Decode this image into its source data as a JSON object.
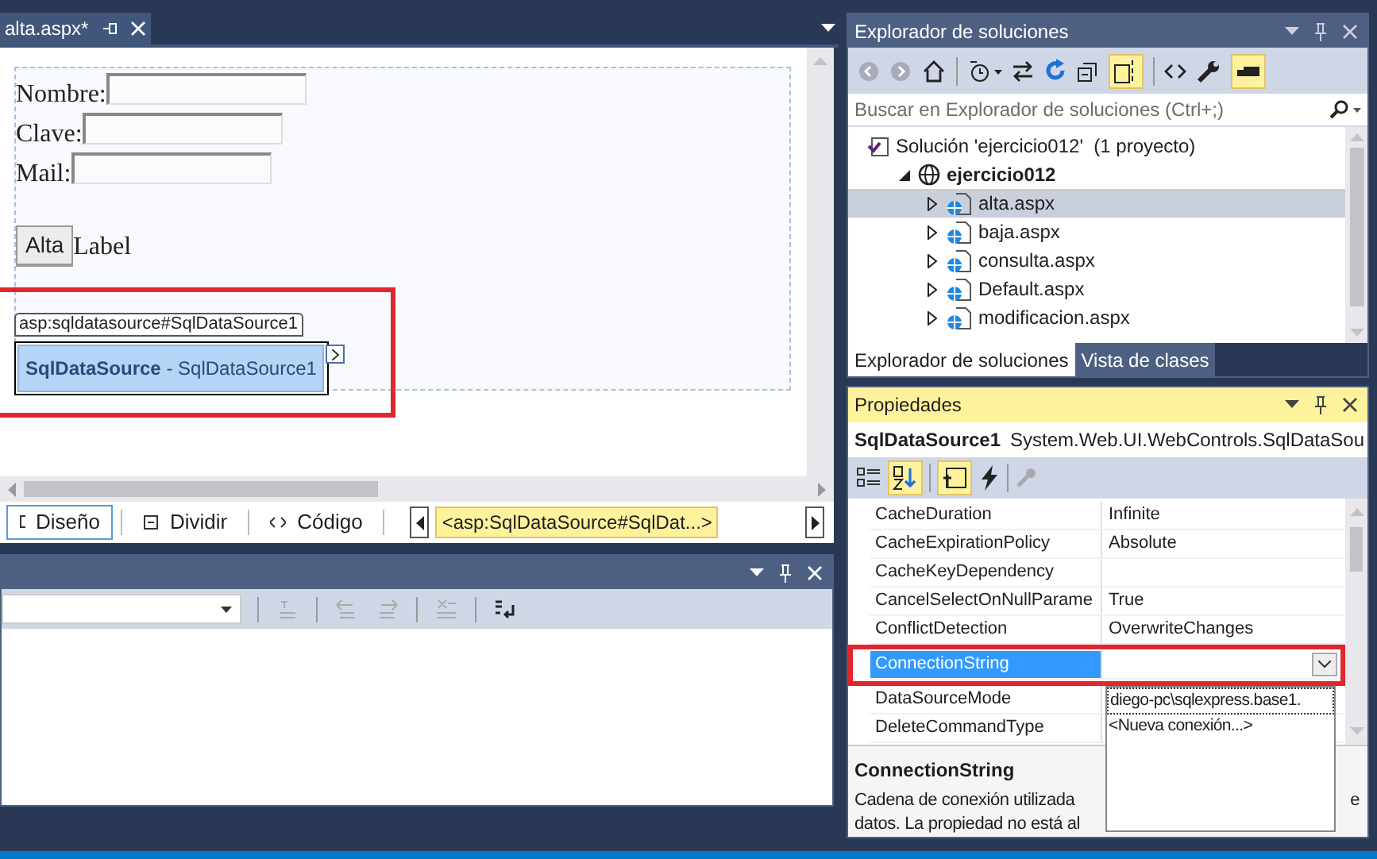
{
  "editor_tab": {
    "title": "alta.aspx*"
  },
  "design_surface": {
    "fields": [
      {
        "label": "Nombre:"
      },
      {
        "label": "Clave:"
      },
      {
        "label": "Mail:"
      }
    ],
    "button": "Alta",
    "label": "Label",
    "smart_tag": {
      "tag": "asp:sqldatasource#SqlDataSource1",
      "caption": "**SqlDataSource** - SqlDataSource1"
    }
  },
  "view_tabs": [
    {
      "label": "Diseño",
      "selected": true
    },
    {
      "label": "Dividir",
      "selected": false
    },
    {
      "label": "Código",
      "selected": false
    }
  ],
  "breadcrumb": "<asp:SqlDataSource#SqlDat...>",
  "solution_explorer": {
    "title": "Explorador de soluciones",
    "search": {
      "placeholder": "Buscar en Explorador de soluciones (Ctrl+;)"
    },
    "tree": [
      {
        "label": "Solución 'ejercicio012'  (1 proyecto)",
        "kind": "solution",
        "selected": false,
        "children": [
          {
            "label": "ejercicio012",
            "kind": "project",
            "expanded": true,
            "selected": false,
            "children": [
              {
                "label": "alta.aspx",
                "kind": "page",
                "expanded": false,
                "selected": true
              },
              {
                "label": "baja.aspx",
                "kind": "page",
                "expanded": false,
                "selected": false
              },
              {
                "label": "consulta.aspx",
                "kind": "page",
                "expanded": false,
                "selected": false
              },
              {
                "label": "Default.aspx",
                "kind": "page",
                "expanded": false,
                "selected": false
              },
              {
                "label": "modificacion.aspx",
                "kind": "page",
                "expanded": false,
                "selected": false
              }
            ]
          }
        ]
      }
    ],
    "tabs": [
      {
        "label": "Explorador de soluciones",
        "selected": true
      },
      {
        "label": "Vista de clases",
        "selected": false
      }
    ]
  },
  "properties": {
    "title": "Propiedades",
    "object": "SqlDataSource1",
    "type": "System.Web.UI.WebControls.SqlDataSou",
    "rows": [
      {
        "name": "CacheDuration",
        "value": "Infinite",
        "selected": false
      },
      {
        "name": "CacheExpirationPolicy",
        "value": "Absolute",
        "selected": false
      },
      {
        "name": "CacheKeyDependency",
        "selected": false
      },
      {
        "name": "CancelSelectOnNullParame",
        "value": "True",
        "selected": false
      },
      {
        "name": "ConflictDetection",
        "value": "OverwriteChanges",
        "selected": false
      },
      {
        "name": "ConnectionString",
        "selected": true
      },
      {
        "name": "DataSourceMode",
        "selected": false
      },
      {
        "name": "DeleteCommandType",
        "selected": false
      }
    ],
    "dropdown": [
      "diego-pc\\sqlexpress.base1.",
      "<Nueva conexión...>"
    ],
    "description": {
      "title": "ConnectionString",
      "lines": [
        {
          "start": "Cadena de conexión utilizada",
          "end": "e"
        },
        {
          "start": "datos. La propiedad no está al"
        }
      ]
    }
  }
}
